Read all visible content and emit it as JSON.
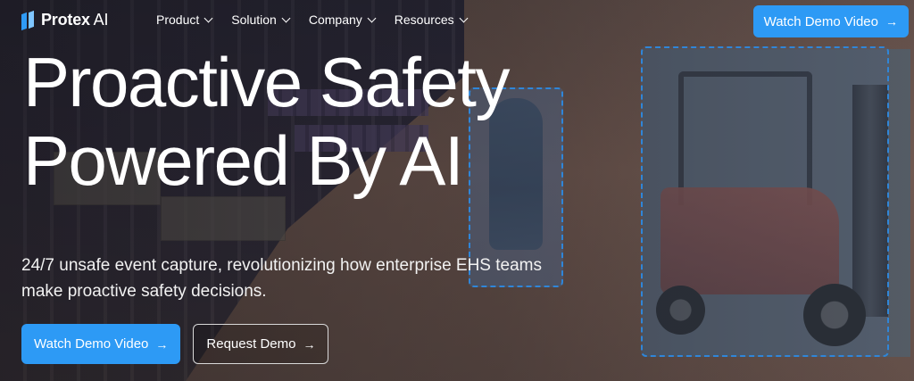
{
  "brand": {
    "name": "Protex",
    "suffix": "AI"
  },
  "nav": [
    {
      "label": "Product"
    },
    {
      "label": "Solution"
    },
    {
      "label": "Company"
    },
    {
      "label": "Resources"
    }
  ],
  "header_cta": {
    "label": "Watch Demo Video",
    "arrow": "→"
  },
  "hero": {
    "title_line1": "Proactive Safety",
    "title_line2": "Powered By AI",
    "subtitle_line1": "24/7 unsafe event capture, revolutionizing how enterprise EHS teams",
    "subtitle_line2": "make proactive safety decisions.",
    "primary_cta": {
      "label": "Watch Demo Video",
      "arrow": "→"
    },
    "secondary_cta": {
      "label": "Request Demo",
      "arrow": "→"
    }
  },
  "colors": {
    "accent": "#2d9af5",
    "detection_box": "#2f86d9"
  },
  "icons": [
    "logo-mark-icon",
    "chevron-down-icon",
    "arrow-right-icon"
  ]
}
